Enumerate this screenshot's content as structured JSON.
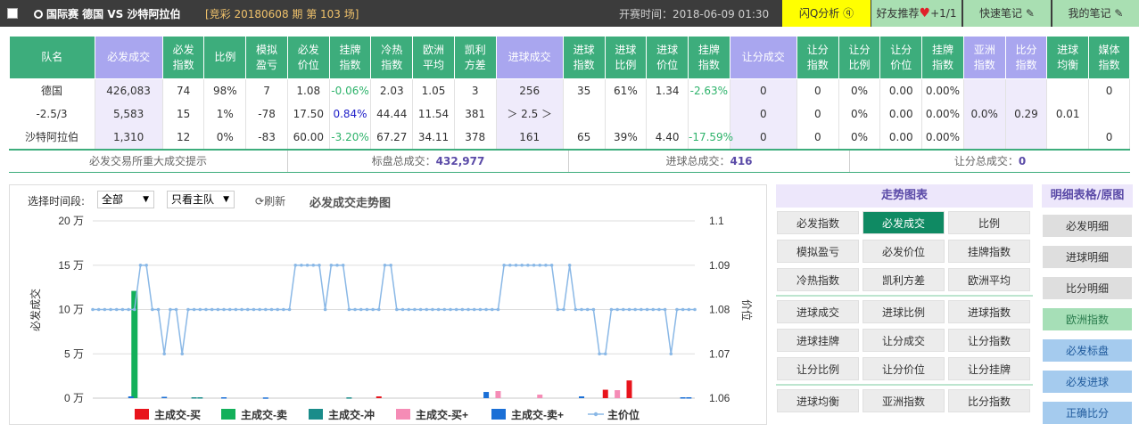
{
  "header": {
    "teams": "国际赛  德国  VS 沙特阿拉伯",
    "issue": "[竞彩 20180608 期 第 103 场]",
    "kickoff": "开赛时间：2018-06-09 01:30",
    "btn_flash": "闪Q分析",
    "btn_friend": "好友推荐",
    "friend_count": "+1/1",
    "btn_note": "快速笔记",
    "btn_mynote": "我的笔记"
  },
  "table": {
    "headers": [
      "队名",
      "必发成交",
      "必发\n指数",
      "比例",
      "模拟\n盈亏",
      "必发\n价位",
      "挂牌\n指数",
      "冷热\n指数",
      "欧洲\n平均",
      "凯利\n方差",
      "进球成交",
      "进球\n指数",
      "进球\n比例",
      "进球\n价位",
      "挂牌\n指数",
      "让分成交",
      "让分\n指数",
      "让分\n比例",
      "让分\n价位",
      "挂牌\n指数",
      "亚洲\n指数",
      "比分\n指数",
      "进球\n均衡",
      "媒体\n指数"
    ],
    "rows": [
      [
        "德国",
        "426,083",
        "74",
        "98%",
        "7",
        "1.08",
        "-0.06%",
        "2.03",
        "1.05",
        "3",
        "256",
        "35",
        "61%",
        "1.34",
        "-2.63%",
        "0",
        "0",
        "0%",
        "0.00",
        "0.00%",
        "",
        "",
        "",
        "0"
      ],
      [
        "-2.5/3",
        "5,583",
        "15",
        "1%",
        "-78",
        "17.50",
        "0.84%",
        "44.44",
        "11.54",
        "381",
        "＞ 2.5 ＞",
        "",
        "",
        "",
        "",
        "0",
        "0",
        "0%",
        "0.00",
        "0.00%",
        "0.0%",
        "0.29",
        "0.01",
        ""
      ],
      [
        "沙特阿拉伯",
        "1,310",
        "12",
        "0%",
        "-83",
        "60.00",
        "-3.20%",
        "67.27",
        "34.11",
        "378",
        "161",
        "65",
        "39%",
        "4.40",
        "-17.59%",
        "0",
        "0",
        "0%",
        "0.00",
        "0.00%",
        "",
        "",
        "",
        "0"
      ]
    ]
  },
  "totals": {
    "hint": "必发交易所重大成交提示",
    "bf_label": "标盘总成交：",
    "bf_value": "432,977",
    "goal_label": "进球总成交：",
    "goal_value": "416",
    "handicap_label": "让分总成交：",
    "handicap_value": "0"
  },
  "chart_controls": {
    "period_label": "选择时间段:",
    "period_value": "全部",
    "team_value": "只看主队",
    "refresh": "刷新",
    "title": "必发成交走势图"
  },
  "chart_data": {
    "type": "bar",
    "title": "必发成交走势图",
    "ylabel": "必发成交",
    "y2label": "价位",
    "ylim": [
      0,
      200000
    ],
    "y_ticks": [
      "0 万",
      "5 万",
      "10 万",
      "15 万",
      "20 万"
    ],
    "y2lim": [
      1.06,
      1.1
    ],
    "y2_ticks": [
      "1.06",
      "1.07",
      "1.08",
      "1.09",
      "1.1"
    ],
    "legend": [
      "主成交-买",
      "主成交-卖",
      "主成交-冲",
      "主成交-买+",
      "主成交-卖+",
      "主价位"
    ],
    "colors": {
      "buy": "#e8141c",
      "sell": "#13b05a",
      "chong": "#1a8c8a",
      "buyplus": "#f58cb6",
      "sellplus": "#1a6fd6",
      "price": "#8ab8e6"
    },
    "price": [
      1.08,
      1.08,
      1.08,
      1.08,
      1.08,
      1.08,
      1.08,
      1.08,
      1.09,
      1.09,
      1.08,
      1.08,
      1.07,
      1.08,
      1.08,
      1.07,
      1.08,
      1.08,
      1.08,
      1.08,
      1.08,
      1.08,
      1.08,
      1.08,
      1.08,
      1.08,
      1.08,
      1.08,
      1.08,
      1.08,
      1.08,
      1.08,
      1.08,
      1.08,
      1.09,
      1.09,
      1.09,
      1.09,
      1.09,
      1.08,
      1.09,
      1.09,
      1.09,
      1.08,
      1.08,
      1.08,
      1.08,
      1.08,
      1.08,
      1.09,
      1.09,
      1.08,
      1.08,
      1.08,
      1.08,
      1.08,
      1.08,
      1.08,
      1.08,
      1.08,
      1.08,
      1.08,
      1.08,
      1.08,
      1.08,
      1.08,
      1.08,
      1.08,
      1.08,
      1.09,
      1.09,
      1.09,
      1.09,
      1.09,
      1.09,
      1.09,
      1.09,
      1.09,
      1.08,
      1.08,
      1.09,
      1.08,
      1.08,
      1.08,
      1.08,
      1.07,
      1.07,
      1.08,
      1.08,
      1.08,
      1.08,
      1.08,
      1.08,
      1.08,
      1.08,
      1.08,
      1.08,
      1.07,
      1.08,
      1.08,
      1.08,
      1.08
    ],
    "bars": [
      {
        "idx": 7,
        "type": "sell",
        "value": 121000
      },
      {
        "idx": 7,
        "type": "sellplus",
        "value": 2000
      },
      {
        "idx": 12,
        "type": "sellplus",
        "value": 1500
      },
      {
        "idx": 17,
        "type": "chong",
        "value": 1000
      },
      {
        "idx": 18,
        "type": "chong",
        "value": 1000
      },
      {
        "idx": 22,
        "type": "sellplus",
        "value": 1000
      },
      {
        "idx": 29,
        "type": "sellplus",
        "value": 800
      },
      {
        "idx": 43,
        "type": "chong",
        "value": 900
      },
      {
        "idx": 48,
        "type": "buy",
        "value": 2000
      },
      {
        "idx": 66,
        "type": "sellplus",
        "value": 7000
      },
      {
        "idx": 68,
        "type": "buyplus",
        "value": 8000
      },
      {
        "idx": 75,
        "type": "buyplus",
        "value": 4000
      },
      {
        "idx": 82,
        "type": "sellplus",
        "value": 2000
      },
      {
        "idx": 86,
        "type": "buy",
        "value": 9500
      },
      {
        "idx": 88,
        "type": "buyplus",
        "value": 9000
      },
      {
        "idx": 90,
        "type": "buy",
        "value": 20000
      },
      {
        "idx": 99,
        "type": "sellplus",
        "value": 1000
      },
      {
        "idx": 100,
        "type": "sellplus",
        "value": 1000
      }
    ]
  },
  "trend_panel": {
    "title": "走势图表",
    "group1": [
      "必发指数",
      "必发成交",
      "比例",
      "模拟盈亏",
      "必发价位",
      "挂牌指数",
      "冷热指数",
      "凯利方差",
      "欧洲平均"
    ],
    "group2": [
      "进球成交",
      "进球比例",
      "进球指数",
      "进球挂牌",
      "让分成交",
      "让分指数",
      "让分比例",
      "让分价位",
      "让分挂牌"
    ],
    "group3": [
      "进球均衡",
      "亚洲指数",
      "比分指数"
    ]
  },
  "detail_panel": {
    "title": "明细表格/原图",
    "items": [
      "必发明细",
      "进球明细",
      "比分明细",
      "欧洲指数",
      "必发标盘",
      "必发进球",
      "正确比分"
    ]
  }
}
